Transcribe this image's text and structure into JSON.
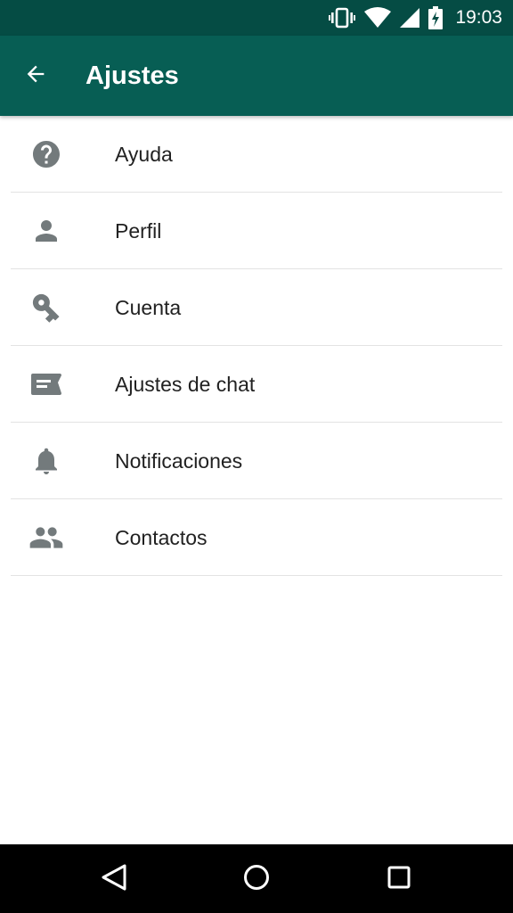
{
  "status_bar": {
    "time": "19:03",
    "icons": [
      "vibrate-icon",
      "wifi-icon",
      "signal-icon",
      "battery-charging-icon"
    ]
  },
  "app_bar": {
    "title": "Ajustes",
    "back_icon": "arrow-back-icon"
  },
  "settings": {
    "items": [
      {
        "label": "Ayuda",
        "icon": "help-icon"
      },
      {
        "label": "Perfil",
        "icon": "person-icon"
      },
      {
        "label": "Cuenta",
        "icon": "key-icon"
      },
      {
        "label": "Ajustes de chat",
        "icon": "chat-icon"
      },
      {
        "label": "Notificaciones",
        "icon": "bell-icon"
      },
      {
        "label": "Contactos",
        "icon": "group-icon"
      }
    ]
  },
  "nav_bar": {
    "buttons": [
      "back-triangle-icon",
      "home-circle-icon",
      "recents-square-icon"
    ]
  },
  "colors": {
    "status_bar": "#054c44",
    "app_bar": "#075e54",
    "icon_gray": "#737a7c",
    "text": "#212121",
    "divider": "#e3e3e3"
  }
}
